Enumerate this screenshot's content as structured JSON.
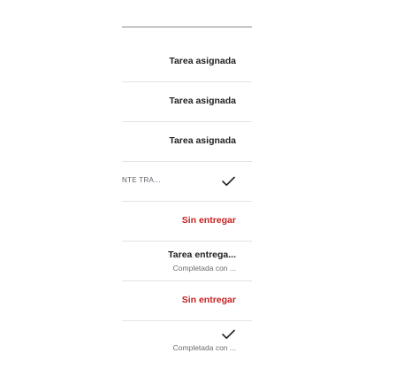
{
  "rows": [
    {
      "type": "text",
      "status": "Tarea asignada"
    },
    {
      "type": "text",
      "status": "Tarea asignada"
    },
    {
      "type": "text",
      "status": "Tarea asignada"
    },
    {
      "type": "check-with-label",
      "label": "NTE TRA...",
      "icon": "checkmark-icon"
    },
    {
      "type": "missing",
      "status": "Sin entregar"
    },
    {
      "type": "two-line",
      "status": "Tarea entrega...",
      "sub": "Completada con ..."
    },
    {
      "type": "missing",
      "status": "Sin entregar"
    },
    {
      "type": "check-sub",
      "icon": "checkmark-icon",
      "sub": "Completada con ..."
    }
  ],
  "colors": {
    "missing": "#c5221f",
    "text": "#202124",
    "subtext": "#6b6b6b",
    "divider": "#e3e3e3"
  }
}
